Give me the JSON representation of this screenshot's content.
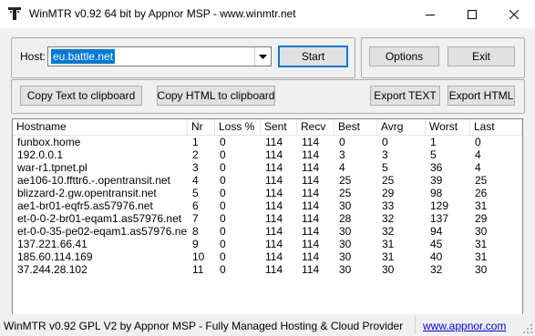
{
  "window": {
    "title": "WinMTR v0.92 64 bit by Appnor MSP - www.winmtr.net"
  },
  "host": {
    "label": "Host:",
    "value": "eu.battle.net"
  },
  "buttons": {
    "start": "Start",
    "options": "Options",
    "exit": "Exit",
    "copy_text": "Copy Text to clipboard",
    "copy_html": "Copy HTML to clipboard",
    "export_text": "Export TEXT",
    "export_html": "Export HTML"
  },
  "table": {
    "columns": [
      "Hostname",
      "Nr",
      "Loss %",
      "Sent",
      "Recv",
      "Best",
      "Avrg",
      "Worst",
      "Last"
    ],
    "rows": [
      [
        "funbox.home",
        "1",
        "0",
        "114",
        "114",
        "0",
        "0",
        "1",
        "0"
      ],
      [
        "192.0.0.1",
        "2",
        "0",
        "114",
        "114",
        "3",
        "3",
        "5",
        "4"
      ],
      [
        "war-r1.tpnet.pl",
        "3",
        "0",
        "114",
        "114",
        "4",
        "5",
        "36",
        "4"
      ],
      [
        "ae106-10.ffttr6.-.opentransit.net",
        "4",
        "0",
        "114",
        "114",
        "25",
        "25",
        "39",
        "25"
      ],
      [
        "blizzard-2.gw.opentransit.net",
        "5",
        "0",
        "114",
        "114",
        "25",
        "29",
        "98",
        "26"
      ],
      [
        "ae1-br01-eqfr5.as57976.net",
        "6",
        "0",
        "114",
        "114",
        "30",
        "33",
        "129",
        "31"
      ],
      [
        "et-0-0-2-br01-eqam1.as57976.net",
        "7",
        "0",
        "114",
        "114",
        "28",
        "32",
        "137",
        "29"
      ],
      [
        "et-0-0-35-pe02-eqam1.as57976.net",
        "8",
        "0",
        "114",
        "114",
        "30",
        "32",
        "94",
        "30"
      ],
      [
        "137.221.66.41",
        "9",
        "0",
        "114",
        "114",
        "30",
        "31",
        "45",
        "31"
      ],
      [
        "185.60.114.169",
        "10",
        "0",
        "114",
        "114",
        "30",
        "31",
        "40",
        "31"
      ],
      [
        "37.244.28.102",
        "11",
        "0",
        "114",
        "114",
        "30",
        "30",
        "32",
        "30"
      ]
    ]
  },
  "status": {
    "text": "WinMTR v0.92 GPL V2 by Appnor MSP - Fully Managed Hosting & Cloud Provider",
    "link": "www.appnor.com"
  }
}
